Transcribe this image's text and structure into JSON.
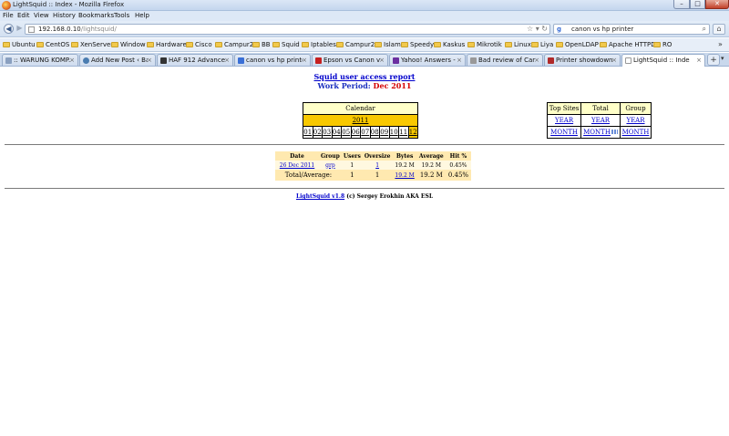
{
  "window": {
    "title": "LightSquid :: Index - Mozilla Firefox",
    "controls": {
      "minimize": "–",
      "maximize": "□",
      "close": "✕"
    }
  },
  "menu": [
    "File",
    "Edit",
    "View",
    "History",
    "Bookmarks",
    "Tools",
    "Help"
  ],
  "nav": {
    "url_host": "192.168.0.10",
    "url_path": "/lightsquid/",
    "search_query": "canon vs hp printer"
  },
  "bookmarks": [
    "Ubuntu",
    "CentOS",
    "XenServer",
    "Window",
    "Hardware",
    "Cisco",
    "Campur2",
    "BB",
    "Squid",
    "Iptables",
    "Campur2",
    "Islam",
    "Speedy",
    "Kaskus",
    "Mikrotik",
    "Linux",
    "Liya",
    "OpenLDAP",
    "Apache HTTPD",
    "RO"
  ],
  "tabs": [
    {
      "label": ":: WARUNG KOMP...",
      "icon": "page-icon"
    },
    {
      "label": "Add New Post ‹ Ba...",
      "icon": "wordpress-icon"
    },
    {
      "label": "HAF 912 Advanced...",
      "icon": "site-icon"
    },
    {
      "label": "canon vs hp printer...",
      "icon": "google-icon"
    },
    {
      "label": "Epson vs Canon vs ...",
      "icon": "site-icon"
    },
    {
      "label": "Yahoo! Answers - P...",
      "icon": "yahoo-icon"
    },
    {
      "label": "Bad review of Cano...",
      "icon": "site-icon"
    },
    {
      "label": "Printer showdown: ...",
      "icon": "site-icon"
    },
    {
      "label": "LightSquid :: Index",
      "icon": "page-icon",
      "active": true
    }
  ],
  "report": {
    "title": "Squid user access report",
    "period_label": "Work Period:",
    "period_value": "Dec 2011"
  },
  "calendar": {
    "header": "Calendar",
    "year": "2011",
    "months": [
      "01",
      "02",
      "03",
      "04",
      "05",
      "06",
      "07",
      "08",
      "09",
      "10",
      "11",
      "12"
    ],
    "selected_month": "12"
  },
  "summary": {
    "headers": [
      "Top Sites",
      "Total",
      "Group"
    ],
    "year_row": [
      "YEAR",
      "YEAR",
      "YEAR"
    ],
    "month_row": [
      "MONTH",
      "MONTH",
      "MONTH"
    ]
  },
  "stats": {
    "headers": [
      "Date",
      "Group",
      "Users",
      "Oversize",
      "Bytes",
      "Average",
      "Hit %"
    ],
    "rows": [
      {
        "date": "26 Dec 2011",
        "group": "grp",
        "users": "1",
        "oversize": "1",
        "bytes": "19.2 M",
        "average": "19.2 M",
        "hit": "0.45%"
      }
    ],
    "total": {
      "label": "Total/Average:",
      "users": "1",
      "oversize": "1",
      "bytes": "19.2 M",
      "average": "19.2 M",
      "hit": "0.45%"
    }
  },
  "footer": {
    "link": "LightSquid v1.8",
    "text": "(c) Sergey Erokhin AKA ESL"
  }
}
